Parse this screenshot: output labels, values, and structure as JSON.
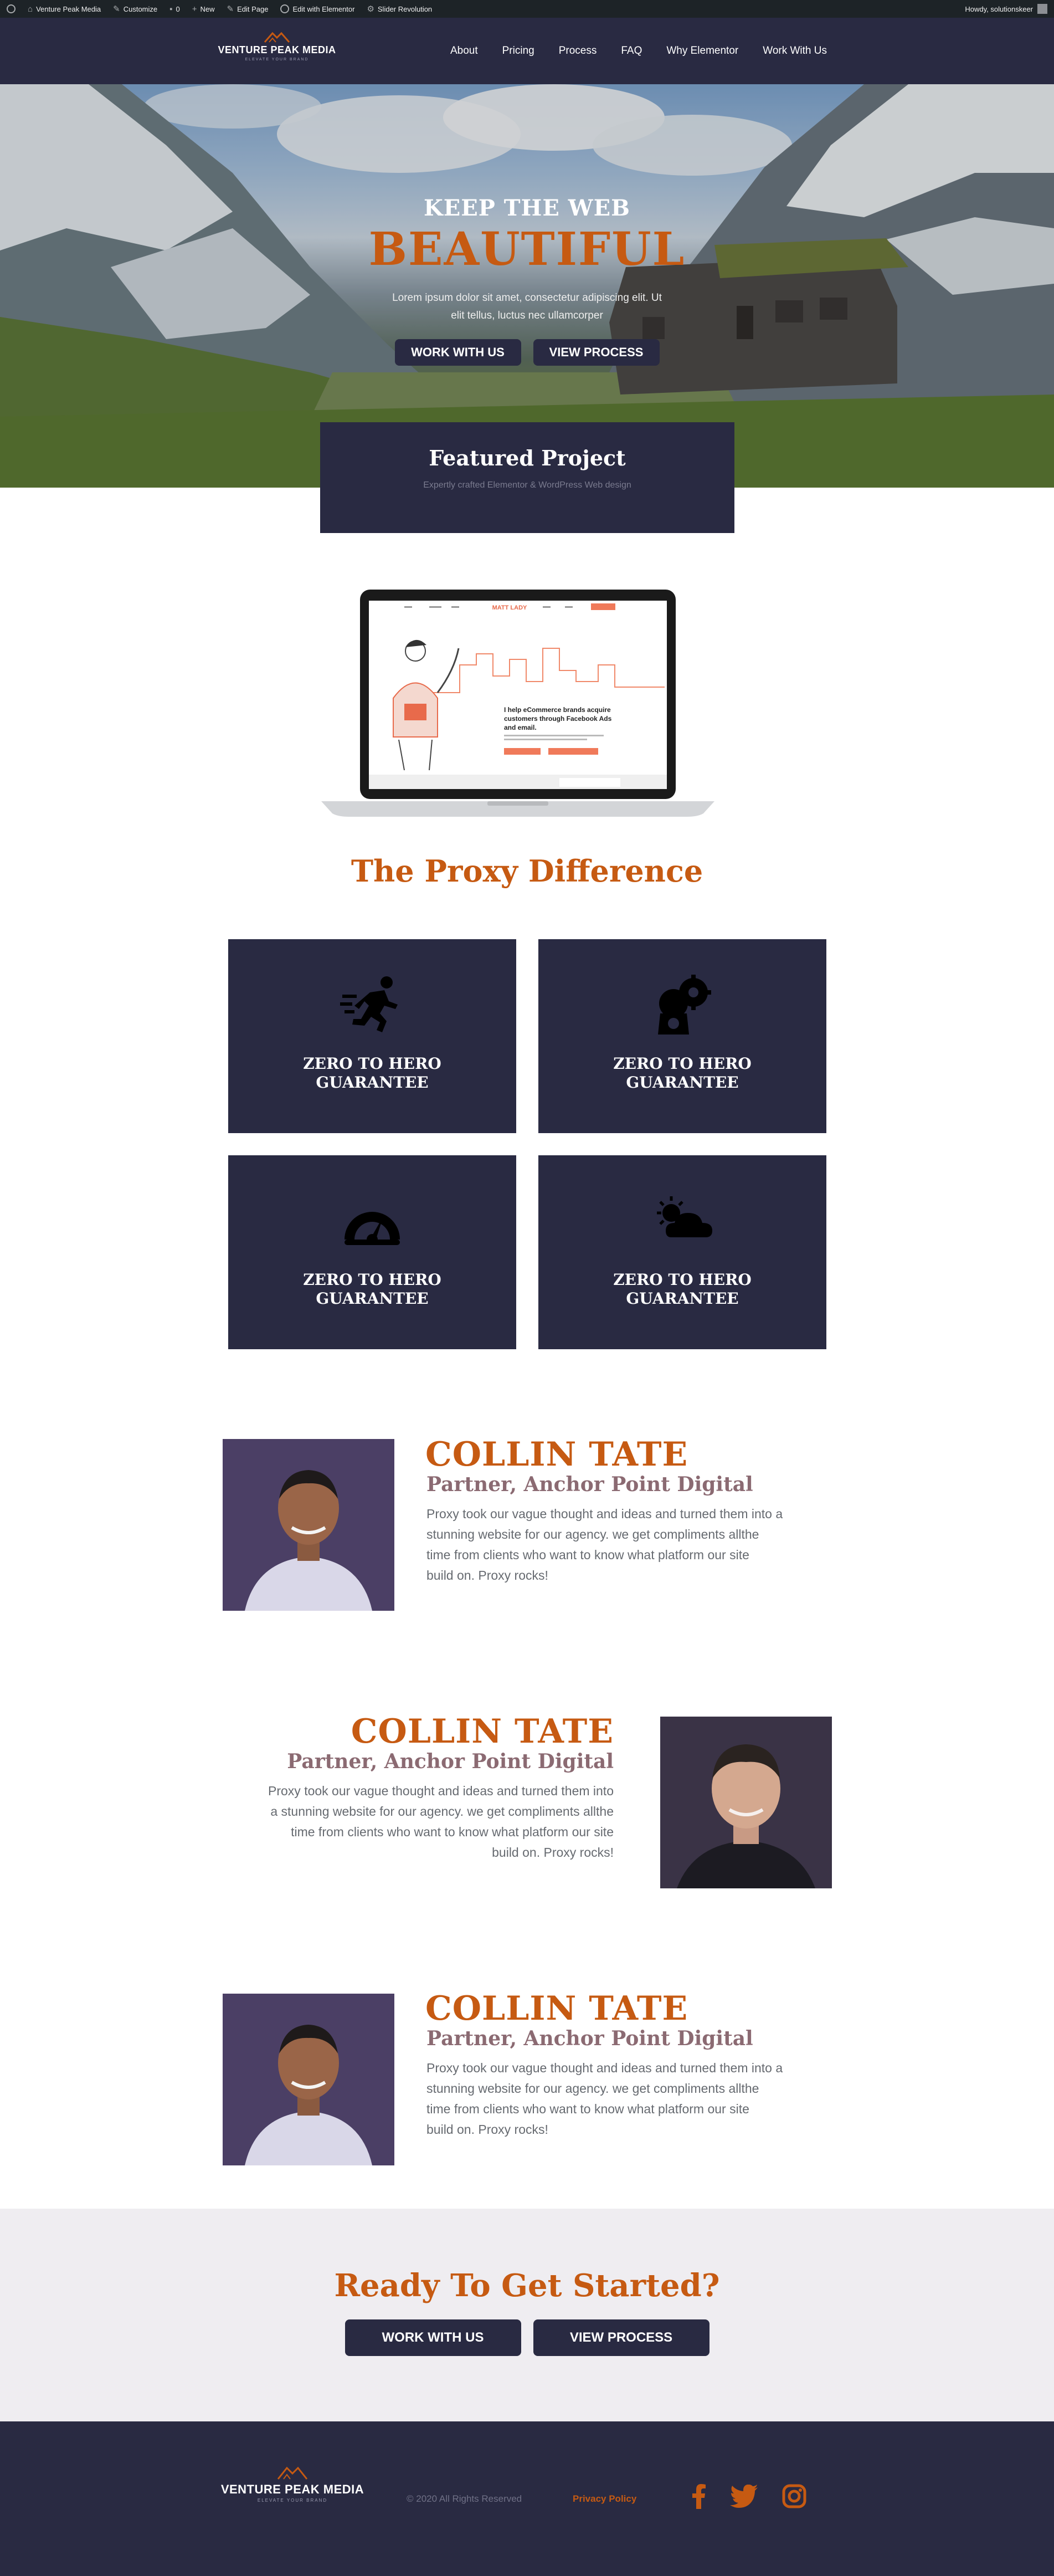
{
  "admin_bar": {
    "items": [
      "Venture Peak Media",
      "Customize",
      "0",
      "New",
      "Edit Page",
      "Edit with Elementor",
      "Slider Revolution"
    ],
    "greeting": "Howdy, solutionskeer"
  },
  "header": {
    "logo_name": "VENTURE PEAK MEDIA",
    "logo_tagline": "ELEVATE YOUR BRAND",
    "nav": [
      "About",
      "Pricing",
      "Process",
      "FAQ",
      "Why Elementor",
      "Work With Us"
    ]
  },
  "hero": {
    "subtitle": "KEEP THE WEB",
    "title": "BEAUTIFUL",
    "description_line1": "Lorem ipsum dolor sit amet, consectetur adipiscing elit. Ut",
    "description_line2": "elit tellus, luctus nec ullamcorper",
    "button_primary": "WORK WITH US",
    "button_secondary": "VIEW PROCESS"
  },
  "featured": {
    "title": "Featured Project",
    "subtitle": "Expertly crafted Elementor & WordPress Web design"
  },
  "laptop_screen": {
    "brand": "MATT LADY",
    "headline_line1": "I help eCommerce brands acquire",
    "headline_line2": "customers through Facebook Ads",
    "headline_line3": "and email."
  },
  "proxy": {
    "title": "The Proxy Difference",
    "cards": [
      {
        "label": "ZERO TO HERO GUARANTEE",
        "icon": "running-person-icon"
      },
      {
        "label": "ZERO TO HERO GUARANTEE",
        "icon": "settings-bag-icon"
      },
      {
        "label": "ZERO TO HERO GUARANTEE",
        "icon": "speedometer-icon"
      },
      {
        "label": "ZERO TO HERO GUARANTEE",
        "icon": "sun-cloud-icon"
      }
    ]
  },
  "testimonials": [
    {
      "name": "COLLIN TATE",
      "role": "Partner, Anchor Point Digital",
      "quote": [
        "Proxy took our vague thought and ideas and turned them into a",
        "stunning website for our agency. we get compliments allthe",
        "time from clients who want to know what platform our site",
        "build on. Proxy rocks!"
      ]
    },
    {
      "name": "COLLIN TATE",
      "role": "Partner, Anchor Point Digital",
      "quote": [
        "Proxy took our vague thought and ideas and turned them into",
        "a stunning website for our agency. we get compliments allthe",
        "time from clients who want to know what platform our site",
        "build on. Proxy rocks!"
      ]
    },
    {
      "name": "COLLIN TATE",
      "role": "Partner, Anchor Point Digital",
      "quote": [
        "Proxy took our vague thought and ideas and turned them into a",
        "stunning website for our agency. we get compliments allthe",
        "time from clients who want to know what platform our site",
        "build on. Proxy rocks!"
      ]
    }
  ],
  "cta": {
    "title": "Ready To Get Started?",
    "button_primary": "WORK WITH US",
    "button_secondary": "VIEW PROCESS"
  },
  "footer": {
    "logo_name": "VENTURE PEAK MEDIA",
    "logo_tagline": "ELEVATE YOUR BRAND",
    "copyright": "© 2020 All Rights Reserved",
    "privacy": "Privacy Policy",
    "social": [
      "facebook-icon",
      "twitter-icon",
      "instagram-icon"
    ]
  },
  "colors": {
    "navy": "#292a42",
    "accent": "#c65a12",
    "cta_bg": "#efedf1"
  }
}
